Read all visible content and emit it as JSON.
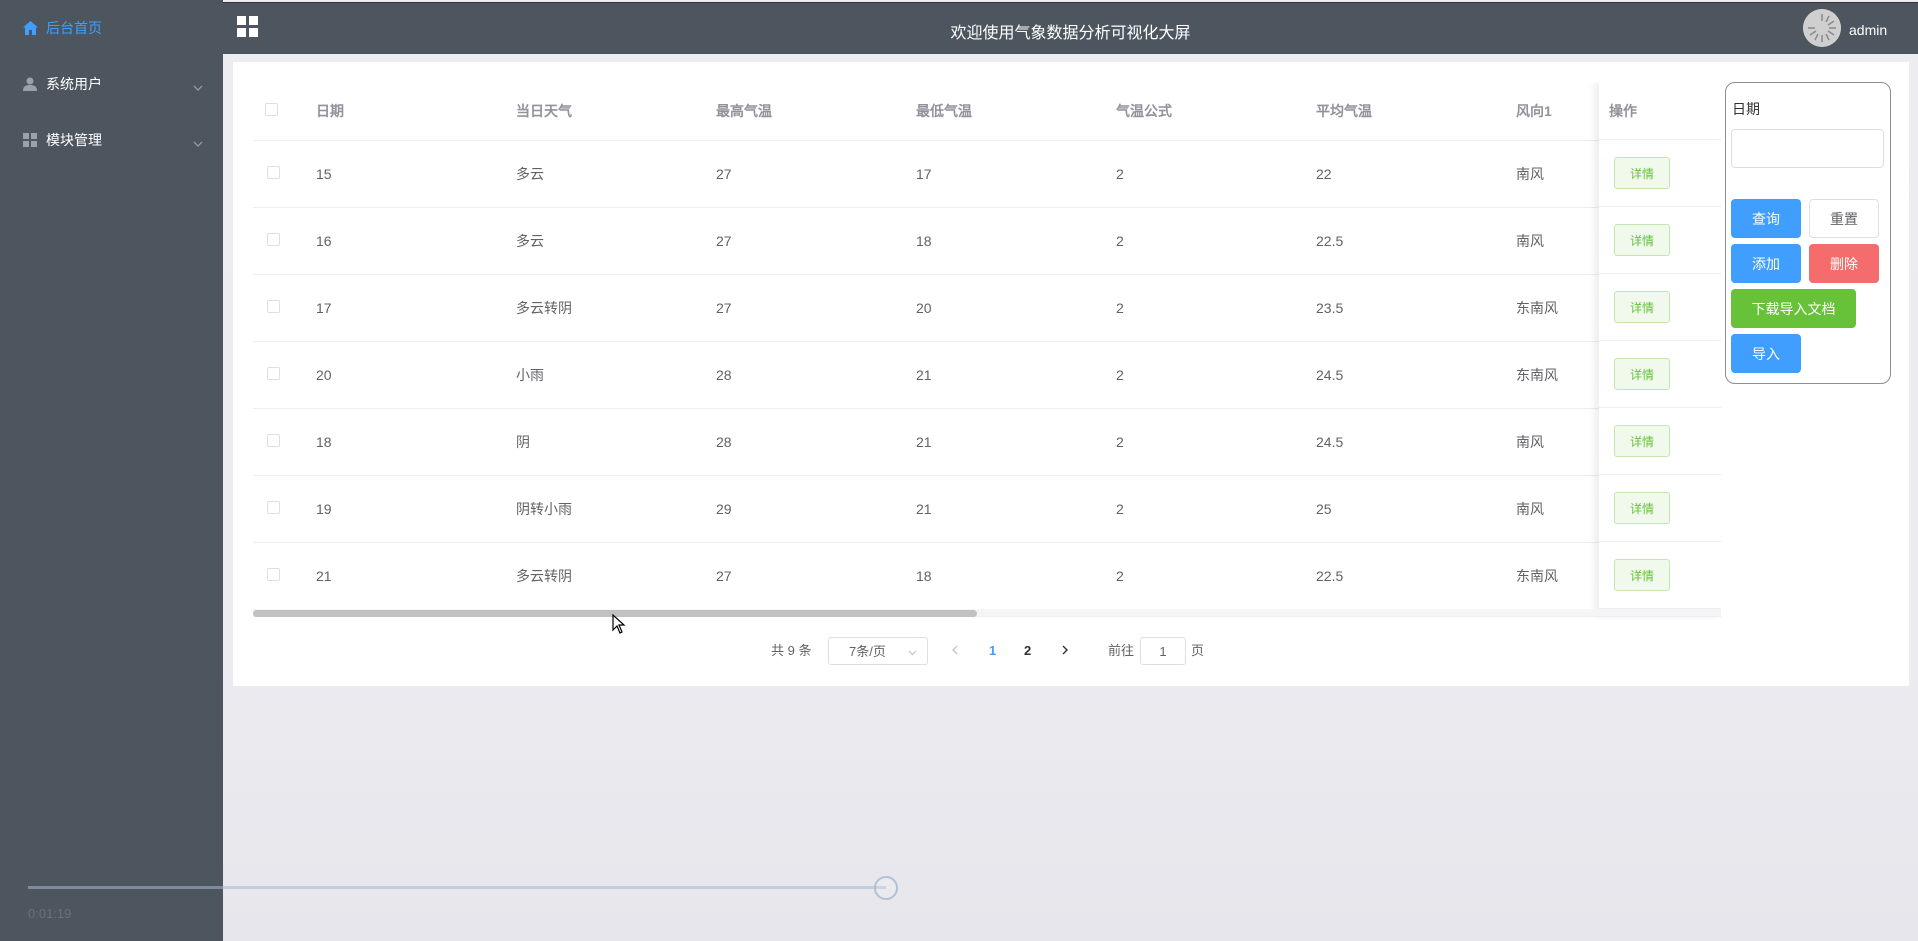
{
  "sidebar": {
    "items": [
      {
        "label": "后台首页",
        "icon": "home-icon",
        "active": true
      },
      {
        "label": "系统用户",
        "icon": "user-icon",
        "expandable": true
      },
      {
        "label": "模块管理",
        "icon": "grid-icon",
        "expandable": true
      }
    ]
  },
  "header": {
    "title": "欢迎使用气象数据分析可视化大屏",
    "username": "admin"
  },
  "table": {
    "columns": [
      "日期",
      "当日天气",
      "最高气温",
      "最低气温",
      "气温公式",
      "平均气温",
      "风向1"
    ],
    "operation_header": "操作",
    "detail_label": "详情",
    "rows": [
      [
        "15",
        "多云",
        "27",
        "17",
        "2",
        "22",
        "南风"
      ],
      [
        "16",
        "多云",
        "27",
        "18",
        "2",
        "22.5",
        "南风"
      ],
      [
        "17",
        "多云转阴",
        "27",
        "20",
        "2",
        "23.5",
        "东南风"
      ],
      [
        "20",
        "小雨",
        "28",
        "21",
        "2",
        "24.5",
        "东南风"
      ],
      [
        "18",
        "阴",
        "28",
        "21",
        "2",
        "24.5",
        "南风"
      ],
      [
        "19",
        "阴转小雨",
        "29",
        "21",
        "2",
        "25",
        "南风"
      ],
      [
        "21",
        "多云转阴",
        "27",
        "18",
        "2",
        "22.5",
        "东南风"
      ]
    ]
  },
  "pagination": {
    "total": "共 9 条",
    "page_size": "7条/页",
    "pages": [
      "1",
      "2"
    ],
    "current_page": "1",
    "goto_label": "前往",
    "goto_value": "1",
    "unit_label": "页"
  },
  "filter": {
    "date_label": "日期",
    "date_value": "",
    "buttons": {
      "query": "查询",
      "reset": "重置",
      "add": "添加",
      "delete": "删除",
      "download": "下载导入文档",
      "import": "导入"
    }
  },
  "video": {
    "time": "0:01:19",
    "progress": 0.82
  },
  "colors": {
    "sidebar_bg": "#4d565e",
    "primary": "#409eff",
    "success": "#67c23a",
    "danger": "#f56c6c"
  }
}
